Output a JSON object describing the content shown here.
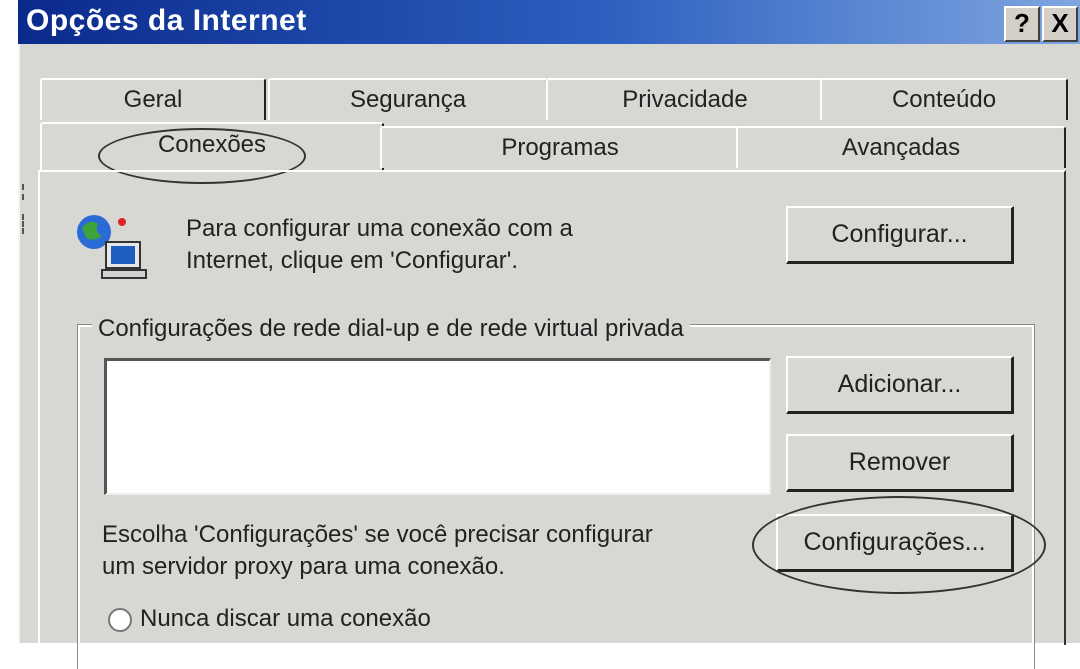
{
  "window": {
    "title": "Opções da Internet",
    "help_button": "?",
    "close_button": "X"
  },
  "tabs_back": [
    "Geral",
    "Segurança",
    "Privacidade",
    "Conteúdo"
  ],
  "tabs_front": [
    "Conexões",
    "Programas",
    "Avançadas"
  ],
  "active_tab": "Conexões",
  "setup": {
    "text_line1": "Para configurar uma conexão com a",
    "text_line2": "Internet, clique em 'Configurar'.",
    "button_label": "Configurar..."
  },
  "dialup_group": {
    "title": "Configurações de rede dial-up e de rede virtual privada",
    "connections": [],
    "add_label": "Adicionar...",
    "remove_label": "Remover"
  },
  "proxy": {
    "text_line1": "Escolha 'Configurações' se você precisar configurar",
    "text_line2": "um servidor proxy para uma conexão.",
    "button_label": "Configurações..."
  },
  "dial_option": {
    "label": "Nunca discar uma conexão"
  },
  "colors": {
    "titlebar_start": "#0a2a8c",
    "titlebar_end": "#7fa6e0",
    "dialog_face": "#d7d7d4"
  }
}
